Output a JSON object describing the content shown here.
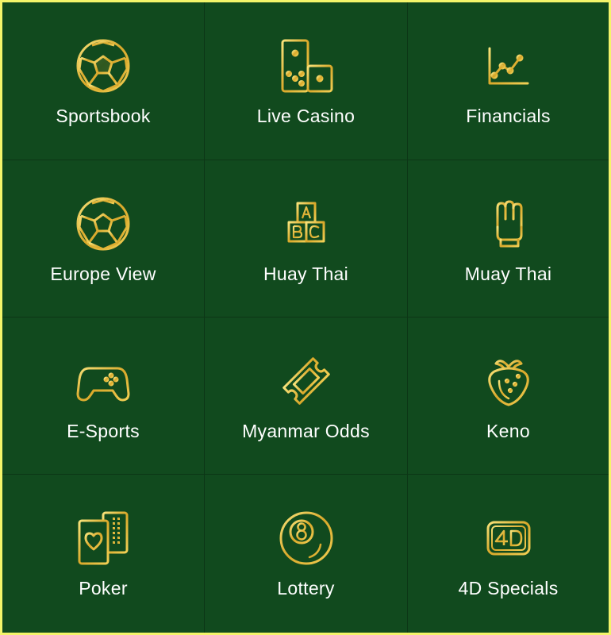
{
  "colors": {
    "background": "#114a1e",
    "border": "#f4f46a",
    "icon_gold": "#e8c34a",
    "label": "#ffffff"
  },
  "menu": {
    "items": [
      {
        "label": "Sportsbook",
        "icon": "soccer-ball-icon"
      },
      {
        "label": "Live Casino",
        "icon": "domino-icon"
      },
      {
        "label": "Financials",
        "icon": "line-chart-icon"
      },
      {
        "label": "Europe View",
        "icon": "soccer-ball-icon"
      },
      {
        "label": "Huay Thai",
        "icon": "abc-blocks-icon"
      },
      {
        "label": "Muay Thai",
        "icon": "boxing-glove-icon"
      },
      {
        "label": "E-Sports",
        "icon": "gamepad-icon"
      },
      {
        "label": "Myanmar Odds",
        "icon": "ticket-icon"
      },
      {
        "label": "Keno",
        "icon": "strawberry-icon"
      },
      {
        "label": "Poker",
        "icon": "playing-cards-icon"
      },
      {
        "label": "Lottery",
        "icon": "eight-ball-icon"
      },
      {
        "label": "4D Specials",
        "icon": "4d-badge-icon"
      }
    ]
  }
}
